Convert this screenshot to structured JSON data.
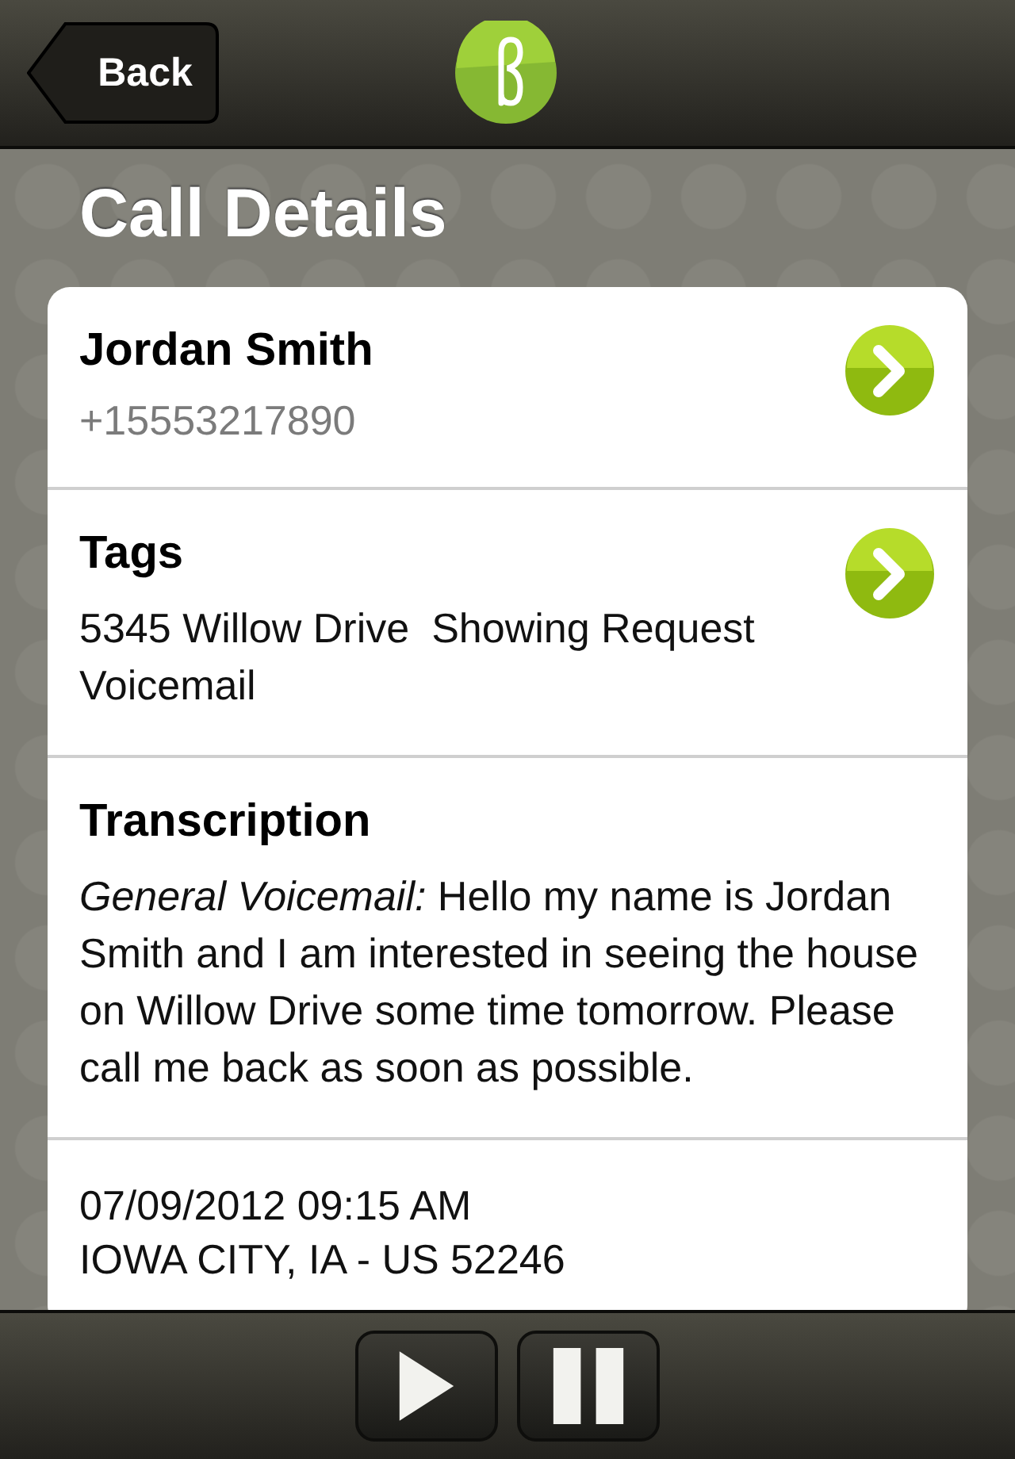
{
  "nav_bar": {
    "back_button": "Back"
  },
  "title": "Call Details",
  "sections": [
    {
      "kind": "contact",
      "heading": "Jordan Smith",
      "subtitle": "+15553217890",
      "has_disclosure": true
    },
    {
      "kind": "tags",
      "heading": "Tags",
      "tags": [
        "5345 Willow Drive",
        "Showing Request",
        "Voicemail"
      ],
      "has_disclosure": true
    },
    {
      "kind": "text",
      "heading": "Transcription",
      "body": "*General Voicemail:* Hello my name is Jordan Smith and I am interested in seeing the house on Willow Drive some time tomorrow. Please call me back as soon as possible."
    },
    {
      "kind": "lines",
      "lines": [
        "07/09/2012 09:15 AM",
        "IOWA CITY, IA - US 52246"
      ]
    }
  ],
  "toolbar": {
    "buttons": [
      {
        "kind": "play"
      },
      {
        "kind": "pause"
      }
    ]
  }
}
